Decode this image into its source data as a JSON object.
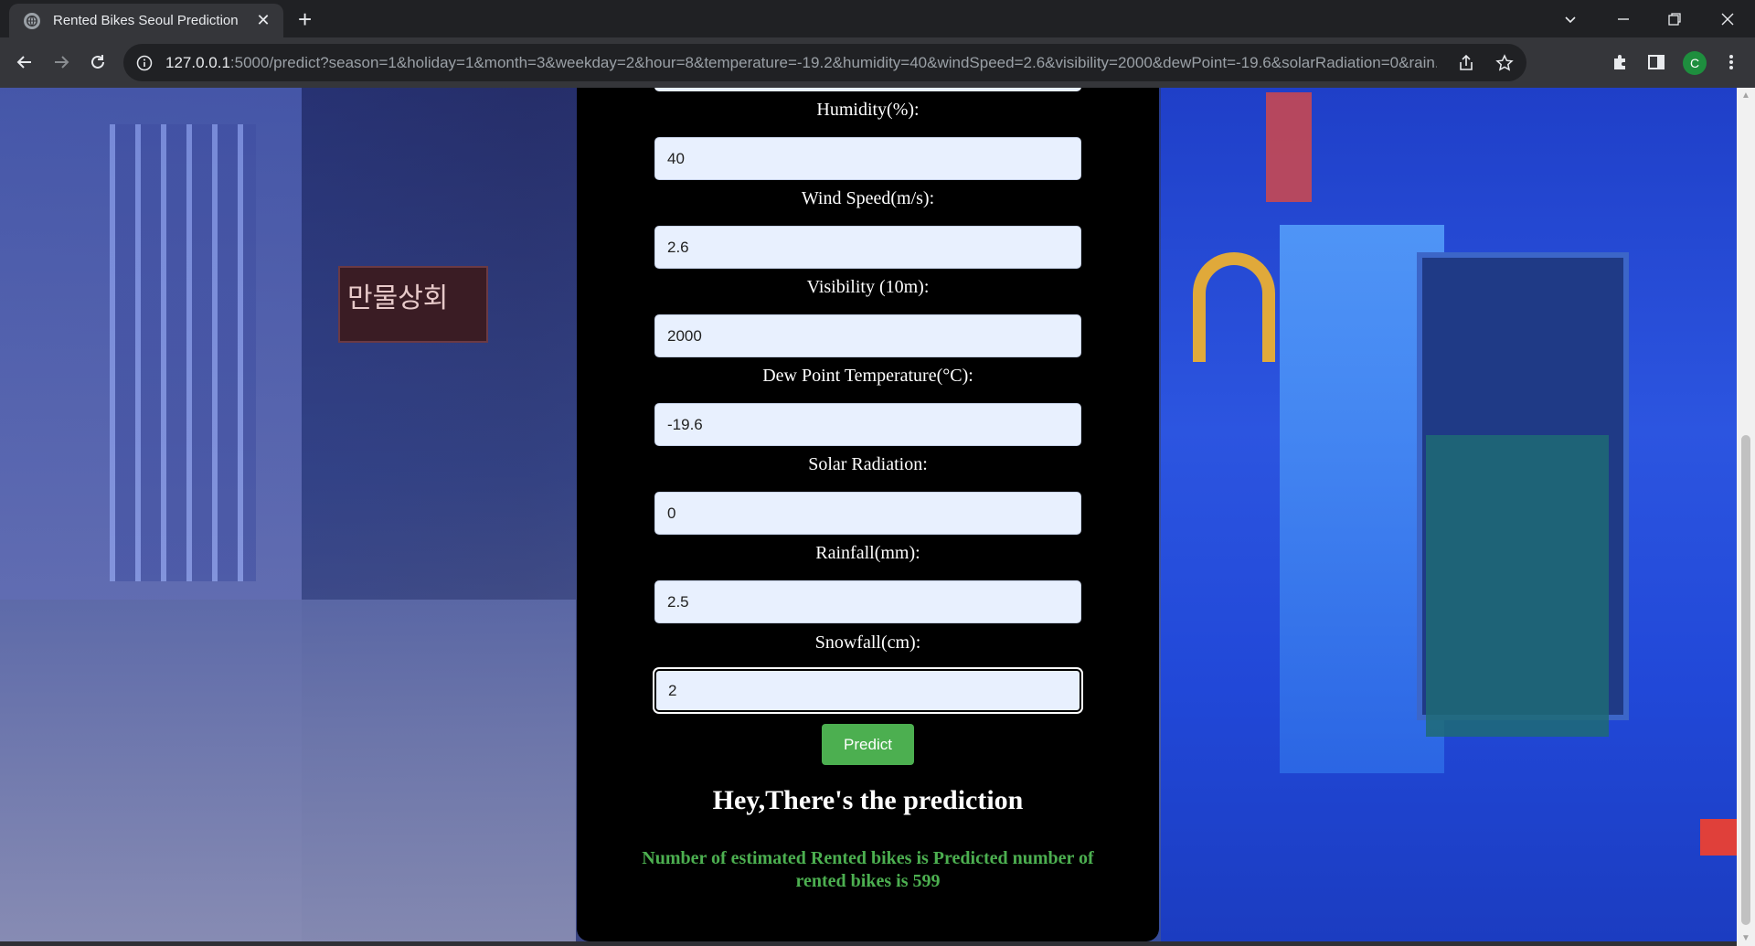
{
  "browser": {
    "tab_title": "Rented Bikes Seoul Prediction",
    "url_host": "127.0.0.1",
    "url_path": ":5000/predict?season=1&holiday=1&month=3&weekday=2&hour=8&temperature=-19.2&humidity=40&windSpeed=2.6&visibility=2000&dewPoint=-19.6&solarRadiation=0&rain...",
    "avatar_letter": "C"
  },
  "form": {
    "fields": [
      {
        "label": "Humidity(%):",
        "value": "40"
      },
      {
        "label": "Wind Speed(m/s):",
        "value": "2.6"
      },
      {
        "label": "Visibility (10m):",
        "value": "2000"
      },
      {
        "label": "Dew Point Temperature(°C):",
        "value": "-19.6"
      },
      {
        "label": "Solar Radiation:",
        "value": "0"
      },
      {
        "label": "Rainfall(mm):",
        "value": "2.5"
      },
      {
        "label": "Snowfall(cm):",
        "value": "2"
      }
    ],
    "predict_label": "Predict"
  },
  "result": {
    "heading": "Hey,There's the prediction",
    "text": "Number of estimated Rented bikes is Predicted number of rented bikes is 599"
  },
  "background": {
    "sign_text": "만물상회"
  },
  "colors": {
    "accent_green": "#4caf50",
    "card_bg": "#000000",
    "input_bg": "#e8f0fe"
  }
}
